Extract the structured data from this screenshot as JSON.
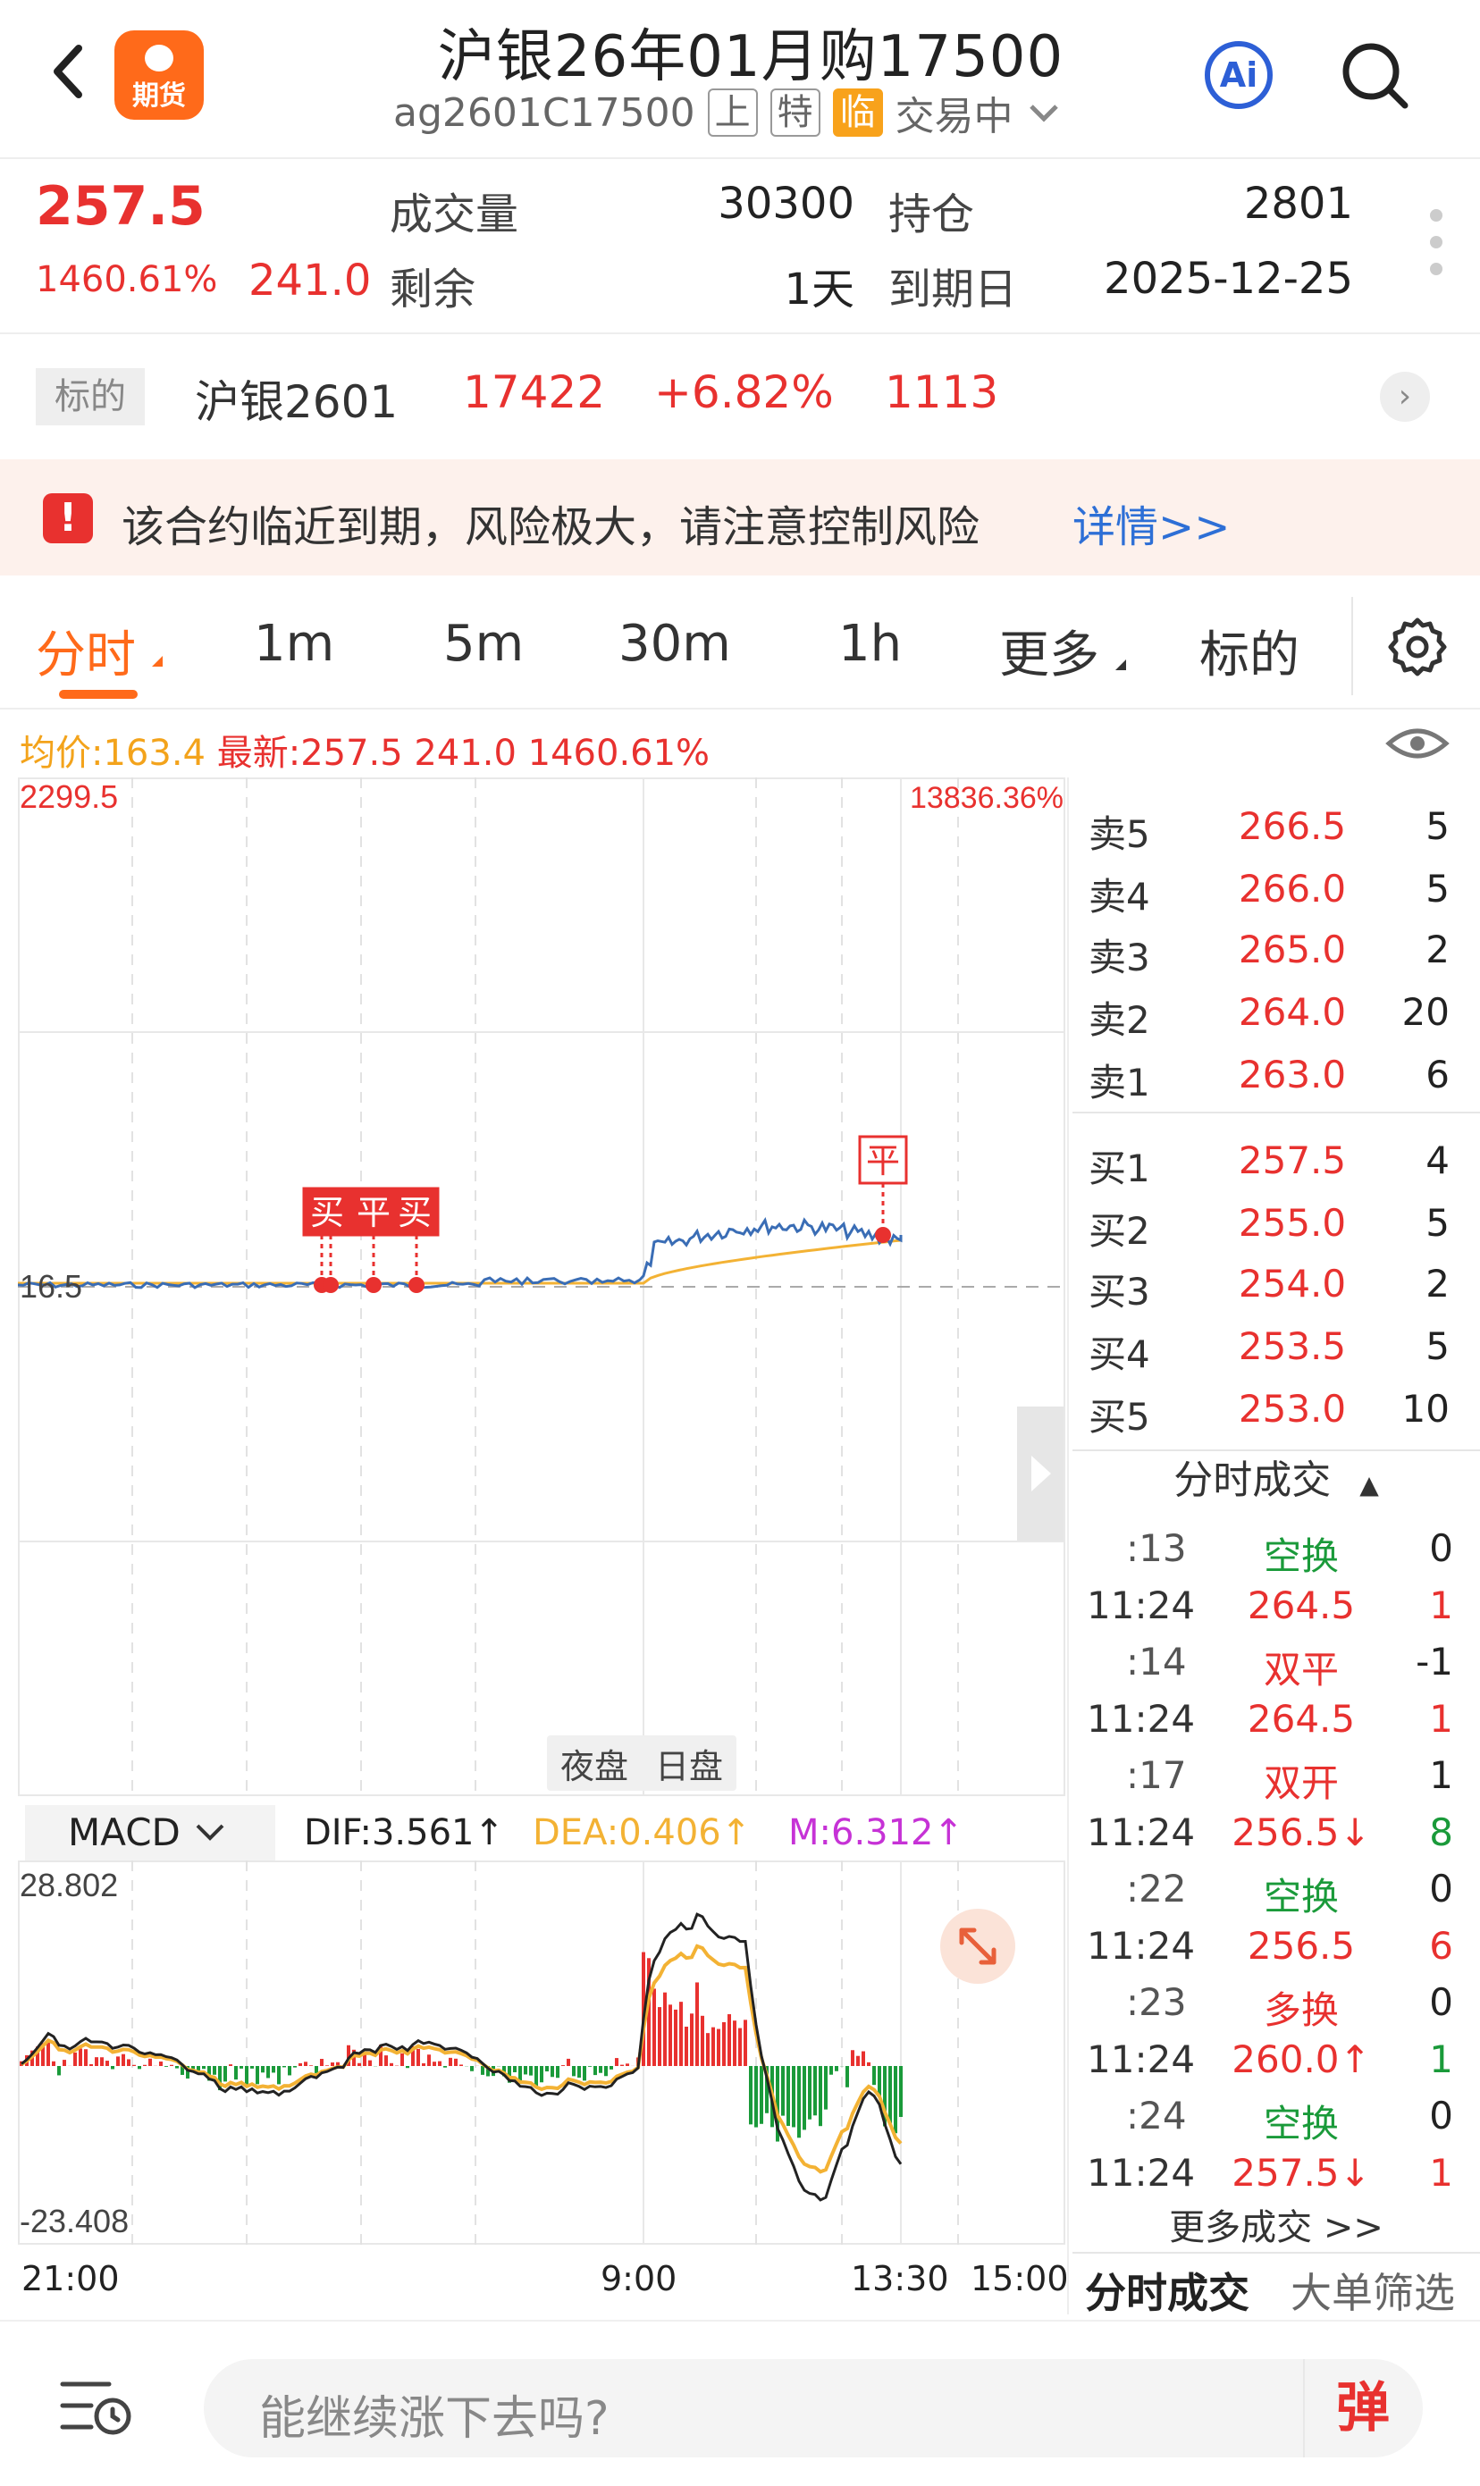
{
  "header": {
    "title": "沪银26年01月购17500",
    "app_logo_text": "期货",
    "code": "ag2601C17500",
    "tags": [
      "上",
      "特",
      "临"
    ],
    "status": "交易中",
    "ai_label": "Ai"
  },
  "quote": {
    "last_price": "257.5",
    "pct_change": "1460.61%",
    "change": "241.0",
    "volume_label": "成交量",
    "volume": "30300",
    "open_interest_label": "持仓",
    "open_interest": "2801",
    "remaining_label": "剩余",
    "remaining": "1天",
    "expiry_label": "到期日",
    "expiry": "2025-12-25"
  },
  "underlying": {
    "tag": "标的",
    "name": "沪银2601",
    "price": "17422",
    "pct": "+6.82%",
    "change": "1113"
  },
  "risk": {
    "text": "该合约临近到期，风险极大，请注意控制风险",
    "link": "详情>>"
  },
  "tabs": [
    "分时",
    "1m",
    "5m",
    "30m",
    "1h",
    "更多",
    "标的"
  ],
  "infoline": {
    "avg": "均价:163.4",
    "latest": "最新:257.5 241.0 1460.61%"
  },
  "chart": {
    "y_top": "2299.5",
    "pct_top": "13836.36%",
    "y_ref": "16.5",
    "session_labels": [
      "夜盘",
      "日盘"
    ],
    "markers": [
      "买",
      "平",
      "买",
      "平"
    ],
    "x_labels": [
      "21:00",
      "9:00",
      "13:30",
      "15:00"
    ]
  },
  "macd": {
    "select": "MACD",
    "dif": "DIF:3.561↑",
    "dea": "DEA:0.406↑",
    "m": "M:6.312↑",
    "y_top": "28.802",
    "y_bottom": "-23.408"
  },
  "orderbook": {
    "asks": [
      {
        "label": "卖5",
        "price": "266.5",
        "qty": "5"
      },
      {
        "label": "卖4",
        "price": "266.0",
        "qty": "5"
      },
      {
        "label": "卖3",
        "price": "265.0",
        "qty": "2"
      },
      {
        "label": "卖2",
        "price": "264.0",
        "qty": "20"
      },
      {
        "label": "卖1",
        "price": "263.0",
        "qty": "6"
      }
    ],
    "bids": [
      {
        "label": "买1",
        "price": "257.5",
        "qty": "4"
      },
      {
        "label": "买2",
        "price": "255.0",
        "qty": "5"
      },
      {
        "label": "买3",
        "price": "254.0",
        "qty": "2"
      },
      {
        "label": "买4",
        "price": "253.5",
        "qty": "5"
      },
      {
        "label": "买5",
        "price": "253.0",
        "qty": "10"
      }
    ]
  },
  "trades": {
    "header": "分时成交",
    "rows": [
      {
        "time": ":13",
        "price": "空换",
        "qty": "0",
        "pc": "green",
        "qc": "dark"
      },
      {
        "time": "11:24",
        "price": "264.5",
        "qty": "1",
        "pc": "red",
        "qc": "red"
      },
      {
        "time": ":14",
        "price": "双平",
        "qty": "-1",
        "pc": "red",
        "qc": "dark"
      },
      {
        "time": "11:24",
        "price": "264.5",
        "qty": "1",
        "pc": "red",
        "qc": "red"
      },
      {
        "time": ":17",
        "price": "双开",
        "qty": "1",
        "pc": "red",
        "qc": "dark"
      },
      {
        "time": "11:24",
        "price": "256.5↓",
        "qty": "8",
        "pc": "red",
        "qc": "green"
      },
      {
        "time": ":22",
        "price": "空换",
        "qty": "0",
        "pc": "green",
        "qc": "dark"
      },
      {
        "time": "11:24",
        "price": "256.5",
        "qty": "6",
        "pc": "red",
        "qc": "red"
      },
      {
        "time": ":23",
        "price": "多换",
        "qty": "0",
        "pc": "red",
        "qc": "dark"
      },
      {
        "time": "11:24",
        "price": "260.0↑",
        "qty": "1",
        "pc": "red",
        "qc": "green"
      },
      {
        "time": ":24",
        "price": "空换",
        "qty": "0",
        "pc": "green",
        "qc": "dark"
      },
      {
        "time": "11:24",
        "price": "257.5↓",
        "qty": "1",
        "pc": "red",
        "qc": "red"
      }
    ],
    "more": "更多成交 >>",
    "tab_trades": "分时成交",
    "tab_big": "大单筛选"
  },
  "comment": {
    "placeholder": "能继续涨下去吗?",
    "danmu": "弹"
  },
  "colors": {
    "accent": "#ff6a1a",
    "up": "#e8312f",
    "down": "#1a9a3a",
    "price_line": "#3a6db5",
    "avg_line": "#f3b234",
    "link": "#2d6fd6"
  }
}
